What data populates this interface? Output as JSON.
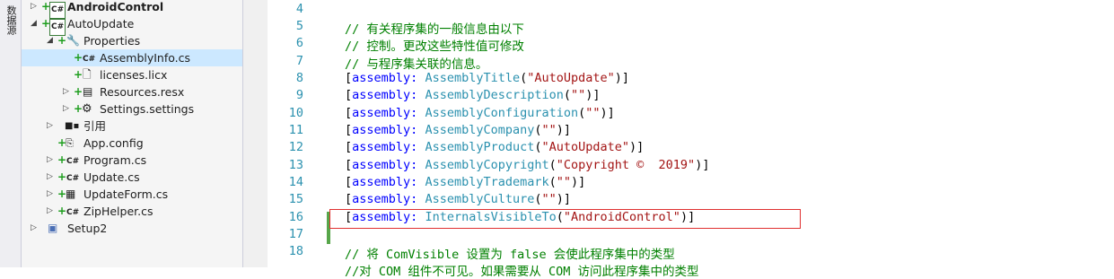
{
  "side_tab": {
    "label": "数据源"
  },
  "explorer": {
    "items": [
      {
        "label": "AndroidControl",
        "icon": "csharp-project-icon",
        "bold": true
      },
      {
        "label": "AutoUpdate",
        "icon": "csharp-project-icon"
      },
      {
        "label": "Properties",
        "icon": "wrench-icon"
      },
      {
        "label": "AssemblyInfo.cs",
        "icon": "csharp-file-icon",
        "selected": true
      },
      {
        "label": "licenses.licx",
        "icon": "file-icon"
      },
      {
        "label": "Resources.resx",
        "icon": "resx-icon"
      },
      {
        "label": "Settings.settings",
        "icon": "gear-icon"
      },
      {
        "label": "引用",
        "icon": "references-icon"
      },
      {
        "label": "App.config",
        "icon": "config-icon"
      },
      {
        "label": "Program.cs",
        "icon": "csharp-file-icon"
      },
      {
        "label": "Update.cs",
        "icon": "csharp-file-icon"
      },
      {
        "label": "UpdateForm.cs",
        "icon": "form-icon"
      },
      {
        "label": "ZipHelper.cs",
        "icon": "csharp-file-icon"
      },
      {
        "label": "Setup2",
        "icon": "setup-project-icon"
      }
    ],
    "cs_glyph": "C#"
  },
  "editor": {
    "line_numbers": [
      "4",
      "5",
      "6",
      "7",
      "8",
      "9",
      "10",
      "11",
      "12",
      "13",
      "14",
      "15",
      "16",
      "17",
      "18"
    ],
    "bracket": "[",
    "assembly_kw": "assembly:",
    "comments": {
      "c5": "// 有关程序集的一般信息由以下",
      "c6": "// 控制。更改这些特性值可修改",
      "c7": "// 与程序集关联的信息。",
      "c18": "// 将 ComVisible 设置为 false 会使此程序集中的类型",
      "c19": "//对 COM 组件不可见。如果需要从 COM 访问此程序集中的类型"
    },
    "attrs": [
      {
        "name": "AssemblyTitle",
        "arg": "\"AutoUpdate\""
      },
      {
        "name": "AssemblyDescription",
        "arg": "\"\""
      },
      {
        "name": "AssemblyConfiguration",
        "arg": "\"\""
      },
      {
        "name": "AssemblyCompany",
        "arg": "\"\""
      },
      {
        "name": "AssemblyProduct",
        "arg": "\"AutoUpdate\""
      },
      {
        "name": "AssemblyCopyright",
        "arg": "\"Copyright ©  2019\""
      },
      {
        "name": "AssemblyTrademark",
        "arg": "\"\""
      },
      {
        "name": "AssemblyCulture",
        "arg": "\"\""
      },
      {
        "name": "InternalsVisibleTo",
        "arg": "\"AndroidControl\""
      }
    ],
    "colors": {
      "comment": "#008000",
      "keyword": "#0000ff",
      "type": "#2b91af",
      "string": "#a31515",
      "highlight": "#e03030"
    }
  }
}
